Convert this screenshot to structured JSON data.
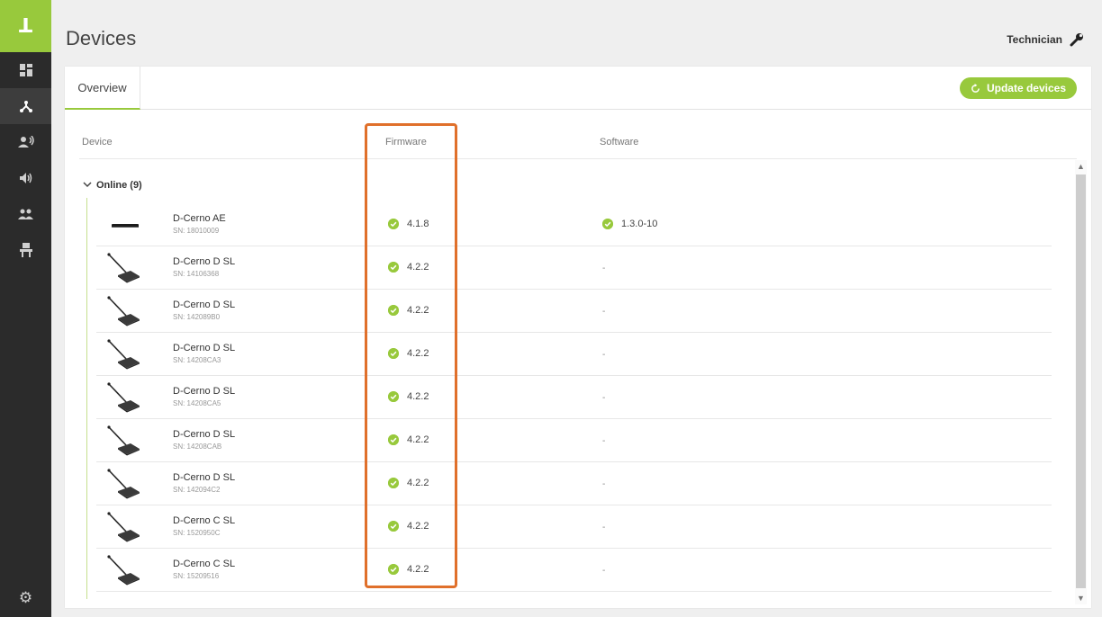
{
  "sidebar": {
    "logo": "ꓕ",
    "items": [
      {
        "name": "dashboard-icon",
        "glyph": "▦"
      },
      {
        "name": "network-icon",
        "glyph": "⅄"
      },
      {
        "name": "participants-icon",
        "glyph": "👤"
      },
      {
        "name": "audio-icon",
        "glyph": "🔊"
      },
      {
        "name": "users-icon",
        "glyph": "👥"
      },
      {
        "name": "seat-icon",
        "glyph": "🪑"
      }
    ],
    "settings_glyph": "⚙"
  },
  "header": {
    "title": "Devices",
    "user": "Technician"
  },
  "tabs": [
    {
      "label": "Overview"
    }
  ],
  "actions": {
    "update_label": "Update devices"
  },
  "columns": {
    "device": "Device",
    "firmware": "Firmware",
    "software": "Software"
  },
  "group": {
    "label": "Online (9)"
  },
  "devices": [
    {
      "name": "D-Cerno AE",
      "sn": "SN: 18010009",
      "firmware": "4.1.8",
      "software": "1.3.0-10",
      "type": "ae"
    },
    {
      "name": "D-Cerno D SL",
      "sn": "SN: 14106368",
      "firmware": "4.2.2",
      "software": "-",
      "type": "mic"
    },
    {
      "name": "D-Cerno D SL",
      "sn": "SN: 142089B0",
      "firmware": "4.2.2",
      "software": "-",
      "type": "mic"
    },
    {
      "name": "D-Cerno D SL",
      "sn": "SN: 14208CA3",
      "firmware": "4.2.2",
      "software": "-",
      "type": "mic"
    },
    {
      "name": "D-Cerno D SL",
      "sn": "SN: 14208CA5",
      "firmware": "4.2.2",
      "software": "-",
      "type": "mic"
    },
    {
      "name": "D-Cerno D SL",
      "sn": "SN: 14208CAB",
      "firmware": "4.2.2",
      "software": "-",
      "type": "mic"
    },
    {
      "name": "D-Cerno D SL",
      "sn": "SN: 142094C2",
      "firmware": "4.2.2",
      "software": "-",
      "type": "mic"
    },
    {
      "name": "D-Cerno C SL",
      "sn": "SN: 1520950C",
      "firmware": "4.2.2",
      "software": "-",
      "type": "mic"
    },
    {
      "name": "D-Cerno C SL",
      "sn": "SN: 15209516",
      "firmware": "4.2.2",
      "software": "-",
      "type": "mic"
    }
  ],
  "colors": {
    "accent": "#98c93c",
    "sidebar": "#2b2b2b",
    "highlight": "#e0702b"
  }
}
